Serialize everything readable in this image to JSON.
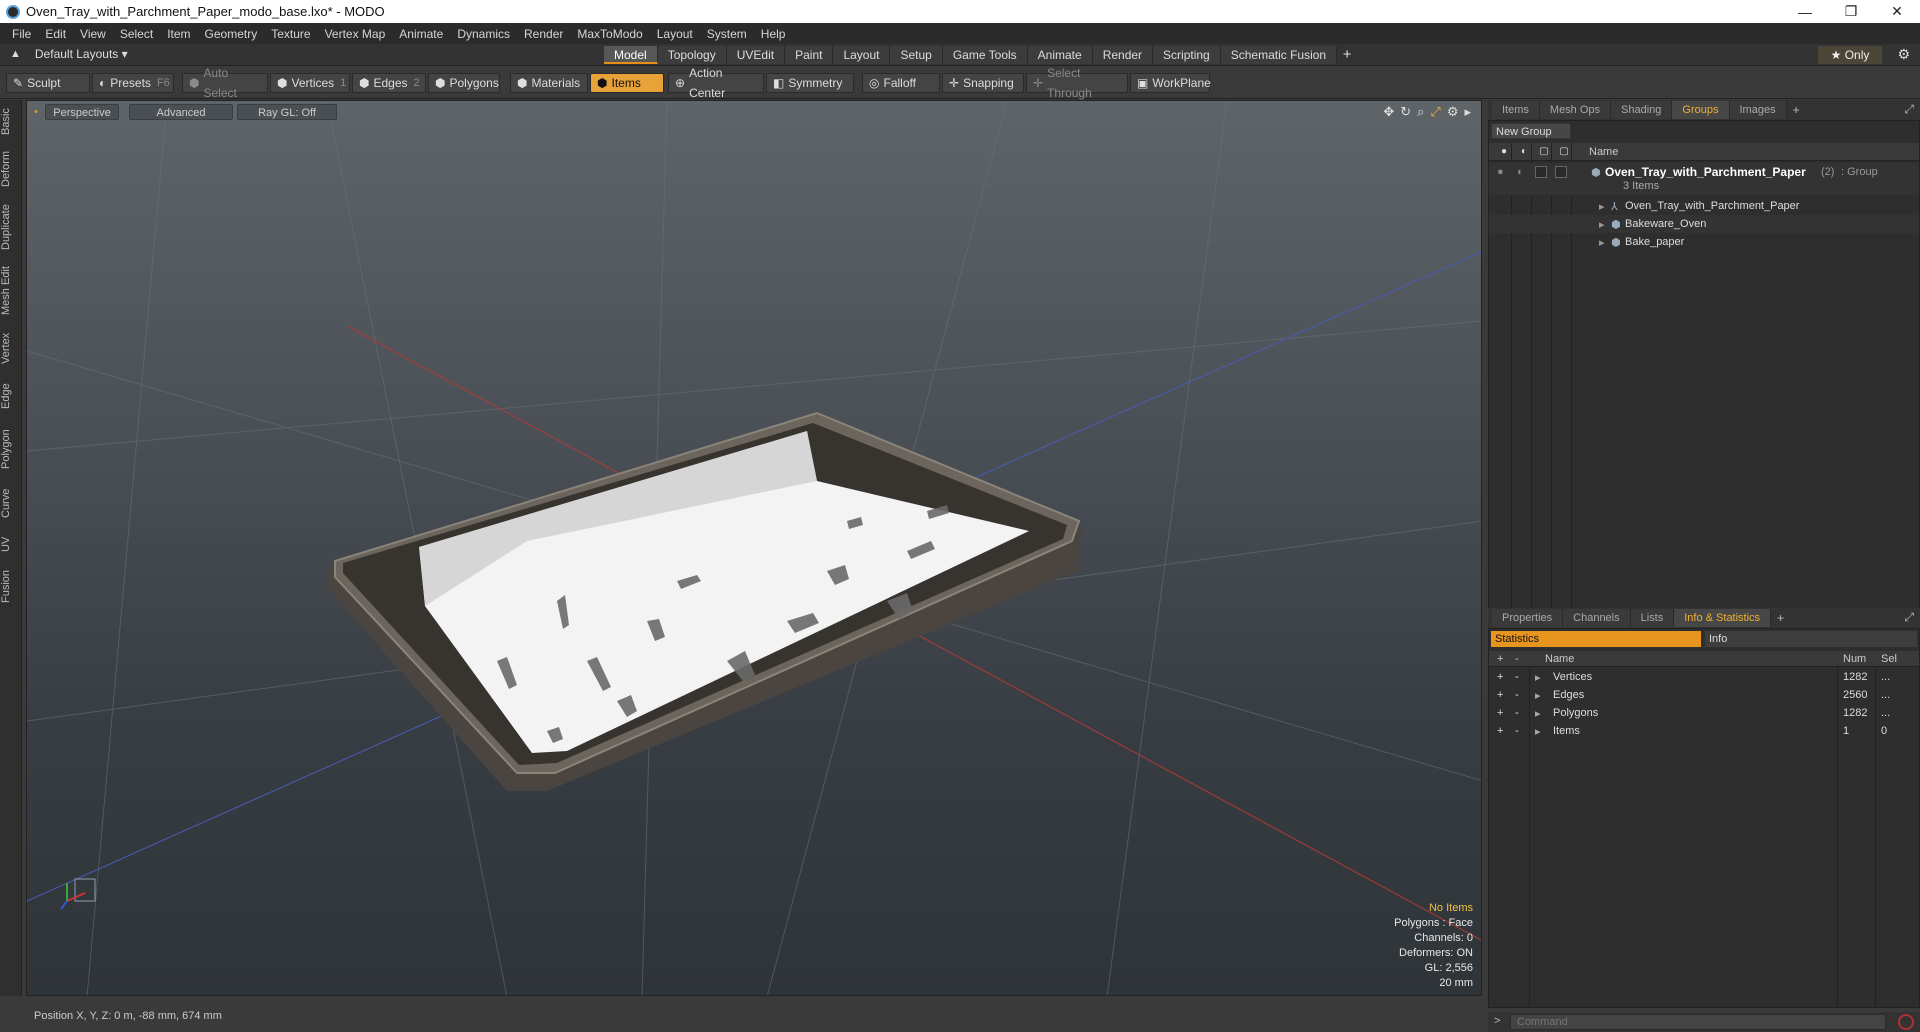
{
  "window": {
    "title": "Oven_Tray_with_Parchment_Paper_modo_base.lxo* - MODO",
    "controls": [
      "—",
      "❐",
      "✕"
    ]
  },
  "menu": [
    "File",
    "Edit",
    "View",
    "Select",
    "Item",
    "Geometry",
    "Texture",
    "Vertex Map",
    "Animate",
    "Dynamics",
    "Render",
    "MaxToModo",
    "Layout",
    "System",
    "Help"
  ],
  "layout": {
    "name": "Default Layouts ▾",
    "tabs": [
      "Model",
      "Topology",
      "UVEdit",
      "Paint",
      "Layout",
      "Setup",
      "Game Tools",
      "Animate",
      "Render",
      "Scripting",
      "Schematic Fusion"
    ],
    "active_tab": "Model",
    "only_label": "★  Only"
  },
  "toolbar": {
    "sculpt": "Sculpt",
    "presets": "Presets",
    "presets_key": "F6",
    "auto_select": "Auto Select",
    "vertices": "Vertices",
    "vertices_key": "1",
    "edges": "Edges",
    "edges_key": "2",
    "polygons": "Polygons",
    "materials": "Materials",
    "items": "Items",
    "action_center": "Action Center",
    "symmetry": "Symmetry",
    "falloff": "Falloff",
    "snapping": "Snapping",
    "select_through": "Select Through",
    "workplane": "WorkPlane"
  },
  "left_tabs": [
    "Basic",
    "Deform",
    "Duplicate",
    "Mesh Edit",
    "Vertex",
    "Edge",
    "Polygon",
    "Curve",
    "UV",
    "Fusion"
  ],
  "viewport": {
    "view": "Perspective",
    "shading": "Advanced",
    "raygl": "Ray GL: Off",
    "info": {
      "no_items": "No Items",
      "polygons": "Polygons : Face",
      "channels": "Channels: 0",
      "deformers": "Deformers: ON",
      "gl": "GL: 2,556",
      "scale": "20 mm"
    }
  },
  "status": {
    "position": "Position X, Y, Z:  0 m, -88 mm, 674 mm"
  },
  "groups_panel": {
    "tabs": [
      "Items",
      "Mesh Ops",
      "Shading",
      "Groups",
      "Images"
    ],
    "active_tab": "Groups",
    "new_group": "New Group",
    "header_name": "Name",
    "group": {
      "name": "Oven_Tray_with_Parchment_Paper",
      "count": "(2)",
      "type": ": Group",
      "items_count": "3 Items"
    },
    "children": [
      "Oven_Tray_with_Parchment_Paper",
      "Bakeware_Oven",
      "Bake_paper"
    ]
  },
  "info_panel": {
    "tabs": [
      "Properties",
      "Channels",
      "Lists",
      "Info & Statistics"
    ],
    "active_tab": "Info & Statistics",
    "subtab_statistics": "Statistics",
    "subtab_info": "Info",
    "headers": {
      "plus": "+",
      "minus": "-",
      "name": "Name",
      "num": "Num",
      "sel": "Sel"
    },
    "rows": [
      {
        "plus": "+",
        "minus": "-",
        "name": "Vertices",
        "num": "1282",
        "sel": "..."
      },
      {
        "plus": "+",
        "minus": "-",
        "name": "Edges",
        "num": "2560",
        "sel": "..."
      },
      {
        "plus": "+",
        "minus": "-",
        "name": "Polygons",
        "num": "1282",
        "sel": "..."
      },
      {
        "plus": "+",
        "minus": "-",
        "name": "Items",
        "num": "1",
        "sel": "0"
      }
    ]
  },
  "command": {
    "placeholder": "Command"
  },
  "colors": {
    "accent": "#e8951f",
    "active_tab_text": "#f0b030",
    "no_items": "#f0c040"
  }
}
